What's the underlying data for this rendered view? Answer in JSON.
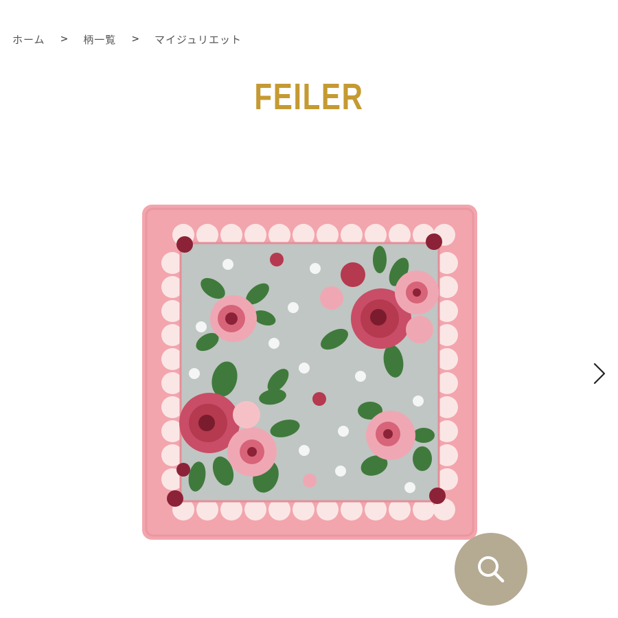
{
  "breadcrumb": {
    "items": [
      {
        "label": "ホーム"
      },
      {
        "label": "柄一覧"
      },
      {
        "label": "マイジュリエット"
      }
    ],
    "separator": ">"
  },
  "brand": {
    "logo_text": "FEILER",
    "color": "#c59a32"
  },
  "product": {
    "image_alt": "",
    "colors": {
      "border": "#f2a5ad",
      "center": "#c0c6c3",
      "lace": "#fbe6e6",
      "rose_dark": "#b5394f",
      "rose_light": "#f0a7b4",
      "leaf": "#3f7a3c"
    }
  },
  "controls": {
    "next_icon": "chevron-right-icon",
    "zoom_icon": "search-icon",
    "zoom_color": "#b5aa92"
  }
}
